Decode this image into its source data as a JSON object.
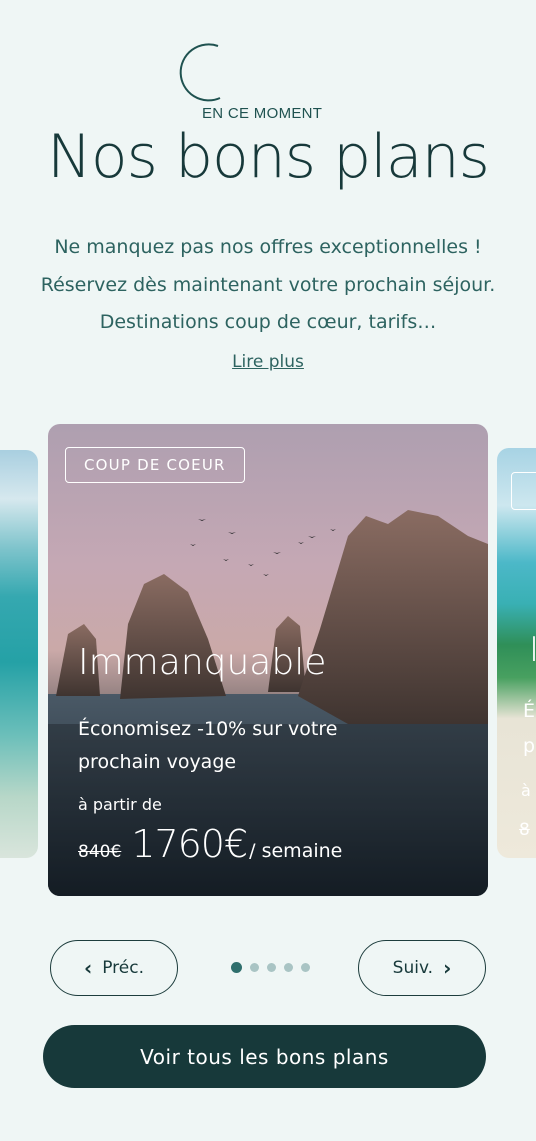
{
  "header": {
    "eyebrow": "EN CE MOMENT",
    "title": "Nos bons plans",
    "intro": "Ne manquez pas nos offres exceptionnelles ! Réservez dès maintenant votre prochain séjour. Destinations coup de cœur, tarifs…",
    "read_more": "Lire plus"
  },
  "carousel": {
    "active_slide": {
      "badge": "COUP DE COEUR",
      "title": "Immanquable",
      "description": "Économisez -10% sur votre prochain voyage",
      "from_label": "à partir de",
      "old_price": "840€",
      "price": "1760€",
      "per": "/ semaine"
    },
    "peek_right": {
      "title_initial": "I",
      "desc_initial_1": "É",
      "desc_initial_2": "p",
      "from_initial": "à",
      "price_initial": "8"
    },
    "prev_label": "Préc.",
    "next_label": "Suiv.",
    "dots_total": 5,
    "dots_active": 1
  },
  "cta": {
    "label": "Voir tous les bons plans"
  },
  "colors": {
    "background": "#eff6f5",
    "primary": "#17393a",
    "text_accent": "#2d6360",
    "dot_active": "#2f6f6d",
    "dot_inactive": "#a9c4c4"
  },
  "icons": {
    "prev": "chevron-left-icon",
    "next": "chevron-right-icon",
    "eyebrow": "arc-icon"
  }
}
